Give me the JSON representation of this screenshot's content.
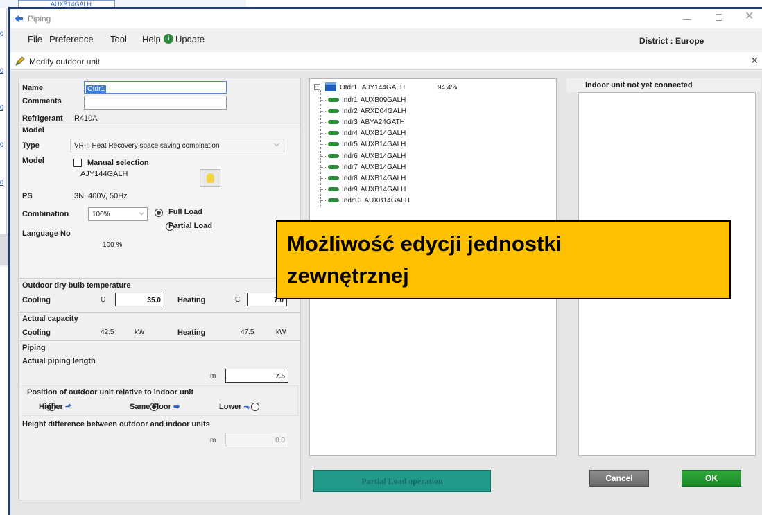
{
  "background": {
    "left_strip_links": [
      "0",
      "0",
      "0",
      "0",
      "0"
    ],
    "top_item": "AUXB14GALH"
  },
  "window": {
    "title": "Piping",
    "icons": {
      "app": "piping-logo-icon",
      "minimize": "minimize-icon",
      "maximize": "maximize-icon",
      "close": "close-icon"
    }
  },
  "menu": {
    "items": [
      "File",
      "Preference",
      "Tool",
      "Help",
      "Update"
    ],
    "district": "District : Europe"
  },
  "dialog": {
    "title": "Modify outdoor unit",
    "close": "×"
  },
  "form": {
    "name_label": "Name",
    "name_value": "Otdr1",
    "comments_label": "Comments",
    "comments_value": "",
    "refrigerant_label": "Refrigerant",
    "refrigerant_value": "R410A",
    "model_section": "Model",
    "type_label": "Type",
    "type_value": "VR-II Heat Recovery space saving combination",
    "model_label": "Model",
    "manual_selection": "Manual selection",
    "model_value": "AJY144GALH",
    "ps_label": "PS",
    "ps_value": "3N, 400V, 50Hz",
    "combination_label": "Combination",
    "combination_value": "100%",
    "full_load": "Full Load",
    "partial_load": "Partial Load",
    "language_label": "Language No",
    "language_value": "100 %",
    "outdoor_section": "Outdoor dry bulb temperature",
    "cooling_label": "Cooling",
    "heating_label": "Heating",
    "unit_c": "C",
    "cooling_temp": "35.0",
    "heating_temp": "7.0",
    "actual_capacity_section": "Actual capacity",
    "cooling_cap": "42.5",
    "heating_cap": "47.5",
    "unit_kw": "kW",
    "piping_section": "Piping",
    "piping_length_label": "Actual piping length",
    "unit_m": "m",
    "piping_length": "7.5",
    "position_label": "Position of outdoor unit relative to indoor unit",
    "higher": "Higher",
    "same_floor": "Same Floor",
    "lower": "Lower",
    "height_label": "Height difference between outdoor and indoor units",
    "height_value": "0.0"
  },
  "tree": {
    "root_name": "Otdr1",
    "root_model": "AJY144GALH",
    "root_percent": "94.4%",
    "children": [
      {
        "name": "Indr1",
        "model": "AUXB09GALH"
      },
      {
        "name": "Indr2",
        "model": "ARXD04GALH"
      },
      {
        "name": "Indr3",
        "model": "ABYA24GATH"
      },
      {
        "name": "Indr4",
        "model": "AUXB14GALH"
      },
      {
        "name": "Indr5",
        "model": "AUXB14GALH"
      },
      {
        "name": "Indr6",
        "model": "AUXB14GALH"
      },
      {
        "name": "Indr7",
        "model": "AUXB14GALH"
      },
      {
        "name": "Indr8",
        "model": "AUXB14GALH"
      },
      {
        "name": "Indr9",
        "model": "AUXB14GALH"
      },
      {
        "name": "Indr10",
        "model": "AUXB14GALH"
      }
    ]
  },
  "right_panel": {
    "title": "Indoor unit not yet connected"
  },
  "buttons": {
    "partial_load_operation": "Partial Load operation",
    "cancel": "Cancel",
    "ok": "OK"
  },
  "overlay": {
    "line1": "Możliwość edycji jednostki",
    "line2": "zewnętrznej",
    "color": "#ffc000"
  }
}
